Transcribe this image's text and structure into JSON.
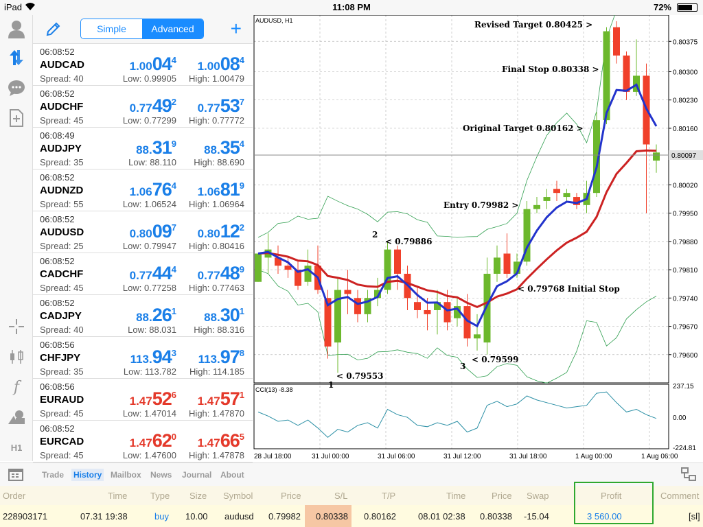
{
  "status": {
    "device": "iPad",
    "time": "11:08 PM",
    "battery": "72%"
  },
  "quotes_header": {
    "simple_label": "Simple",
    "advanced_label": "Advanced"
  },
  "quotes": [
    {
      "time": "06:08:52",
      "symbol": "AUDCAD",
      "spread": "Spread: 40",
      "low": "Low: 0.99905",
      "high": "High: 1.00479",
      "bid": [
        "1.00",
        "04",
        "4"
      ],
      "ask": [
        "1.00",
        "08",
        "4"
      ],
      "color": "blue"
    },
    {
      "time": "06:08:52",
      "symbol": "AUDCHF",
      "spread": "Spread: 45",
      "low": "Low: 0.77299",
      "high": "High: 0.77772",
      "bid": [
        "0.77",
        "49",
        "2"
      ],
      "ask": [
        "0.77",
        "53",
        "7"
      ],
      "color": "blue"
    },
    {
      "time": "06:08:49",
      "symbol": "AUDJPY",
      "spread": "Spread: 35",
      "low": "Low: 88.110",
      "high": "High: 88.690",
      "bid": [
        "88.",
        "31",
        "9"
      ],
      "ask": [
        "88.",
        "35",
        "4"
      ],
      "color": "blue"
    },
    {
      "time": "06:08:52",
      "symbol": "AUDNZD",
      "spread": "Spread: 55",
      "low": "Low: 1.06524",
      "high": "High: 1.06964",
      "bid": [
        "1.06",
        "76",
        "4"
      ],
      "ask": [
        "1.06",
        "81",
        "9"
      ],
      "color": "blue"
    },
    {
      "time": "06:08:52",
      "symbol": "AUDUSD",
      "spread": "Spread: 25",
      "low": "Low: 0.79947",
      "high": "High: 0.80416",
      "bid": [
        "0.80",
        "09",
        "7"
      ],
      "ask": [
        "0.80",
        "12",
        "2"
      ],
      "color": "blue"
    },
    {
      "time": "06:08:52",
      "symbol": "CADCHF",
      "spread": "Spread: 45",
      "low": "Low: 0.77258",
      "high": "High: 0.77463",
      "bid": [
        "0.77",
        "44",
        "4"
      ],
      "ask": [
        "0.77",
        "48",
        "9"
      ],
      "color": "blue"
    },
    {
      "time": "06:08:52",
      "symbol": "CADJPY",
      "spread": "Spread: 40",
      "low": "Low: 88.031",
      "high": "High: 88.316",
      "bid": [
        "88.",
        "26",
        "1"
      ],
      "ask": [
        "88.",
        "30",
        "1"
      ],
      "color": "blue"
    },
    {
      "time": "06:08:56",
      "symbol": "CHFJPY",
      "spread": "Spread: 35",
      "low": "Low: 113.782",
      "high": "High: 114.185",
      "bid": [
        "113.",
        "94",
        "3"
      ],
      "ask": [
        "113.",
        "97",
        "8"
      ],
      "color": "blue"
    },
    {
      "time": "06:08:56",
      "symbol": "EURAUD",
      "spread": "Spread: 45",
      "low": "Low: 1.47014",
      "high": "High: 1.47870",
      "bid": [
        "1.47",
        "52",
        "6"
      ],
      "ask": [
        "1.47",
        "57",
        "1"
      ],
      "color": "red"
    },
    {
      "time": "06:08:52",
      "symbol": "EURCAD",
      "spread": "Spread: 45",
      "low": "Low: 1.47600",
      "high": "High: 1.47878",
      "bid": [
        "1.47",
        "62",
        "0"
      ],
      "ask": [
        "1.47",
        "66",
        "5"
      ],
      "color": "red"
    }
  ],
  "chart": {
    "title": "AUDUSD, H1",
    "price_labels": [
      "0.80375",
      "0.80300",
      "0.80230",
      "0.80160",
      "0.80020",
      "0.79950",
      "0.79880",
      "0.79810",
      "0.79740",
      "0.79670",
      "0.79600"
    ],
    "current_price": "0.80097",
    "time_labels": [
      "28 Jul 18:00",
      "31 Jul 00:00",
      "31 Jul 06:00",
      "31 Jul 12:00",
      "31 Jul 18:00",
      "1 Aug 00:00",
      "1 Aug 06:00"
    ],
    "cci_label": "CCI(13) -8.38",
    "cci_scale": [
      "237.15",
      "0.00",
      "-224.81"
    ],
    "annotations": {
      "revised_target": "Revised Target 0.80425 >",
      "final_stop": "Final Stop 0.80338 >",
      "original_target": "Original Target 0.80162 >",
      "entry": "Entry 0.79982 >",
      "initial_stop": "< 0.79768 Initial Stop",
      "p1_value": "< 0.79553",
      "p2_value": "< 0.79886",
      "p3_value": "< 0.79599",
      "p1": "1",
      "p2": "2",
      "p3": "3"
    },
    "colors": {
      "bull": "#6cb82c",
      "bear": "#f0402a",
      "ema_fast": "#2233cc",
      "ema_slow": "#cc2222",
      "band": "#2e9e4e"
    },
    "candles": [
      [
        0.7978,
        0.7985,
        0.7985,
        0.7978
      ],
      [
        0.7984,
        0.7986,
        0.799,
        0.798
      ],
      [
        0.7984,
        0.7982,
        0.7987,
        0.798
      ],
      [
        0.7982,
        0.7981,
        0.7984,
        0.7979
      ],
      [
        0.7981,
        0.7977,
        0.7983,
        0.7976
      ],
      [
        0.7978,
        0.7982,
        0.7986,
        0.7977
      ],
      [
        0.7982,
        0.7976,
        0.7987,
        0.7975
      ],
      [
        0.7974,
        0.7962,
        0.7976,
        0.7959
      ],
      [
        0.7963,
        0.7976,
        0.7979,
        0.79555
      ],
      [
        0.7976,
        0.7975,
        0.7981,
        0.797
      ],
      [
        0.7974,
        0.797,
        0.7976,
        0.7968
      ],
      [
        0.797,
        0.7974,
        0.7976,
        0.7968
      ],
      [
        0.7974,
        0.7976,
        0.7979,
        0.7972
      ],
      [
        0.7976,
        0.7986,
        0.7988,
        0.7975
      ],
      [
        0.7986,
        0.798,
        0.7987,
        0.7976
      ],
      [
        0.798,
        0.7974,
        0.7982,
        0.7971
      ],
      [
        0.7973,
        0.7971,
        0.7977,
        0.7969
      ],
      [
        0.7971,
        0.797,
        0.7974,
        0.7966
      ],
      [
        0.7971,
        0.7973,
        0.7976,
        0.7965
      ],
      [
        0.7973,
        0.7968,
        0.7976,
        0.7966
      ],
      [
        0.7969,
        0.7972,
        0.7974,
        0.7967
      ],
      [
        0.7972,
        0.7964,
        0.7975,
        0.7962
      ],
      [
        0.7964,
        0.7965,
        0.797,
        0.7961
      ],
      [
        0.7963,
        0.798,
        0.7984,
        0.796
      ],
      [
        0.798,
        0.7984,
        0.7987,
        0.7978
      ],
      [
        0.7985,
        0.798,
        0.799,
        0.7979
      ],
      [
        0.798,
        0.7983,
        0.7985,
        0.7979
      ],
      [
        0.7983,
        0.7996,
        0.7998,
        0.7982
      ],
      [
        0.7996,
        0.7997,
        0.7999,
        0.7995
      ],
      [
        0.7998,
        0.7999,
        0.8001,
        0.7996
      ],
      [
        0.8001,
        0.8,
        0.8003,
        0.7998
      ],
      [
        0.7999,
        0.8,
        0.8001,
        0.7998
      ],
      [
        0.7999,
        0.7997,
        0.8,
        0.7996
      ],
      [
        0.7997,
        0.8,
        0.8003,
        0.7995
      ],
      [
        0.8,
        0.8018,
        0.802,
        0.7999
      ],
      [
        0.8018,
        0.804,
        0.8041,
        0.8017
      ],
      [
        0.8041,
        0.8034,
        0.80425,
        0.8032
      ],
      [
        0.8034,
        0.8025,
        0.8035,
        0.8023
      ],
      [
        0.8025,
        0.8029,
        0.8038,
        0.8024
      ],
      [
        0.8029,
        0.8012,
        0.8032,
        0.7995
      ],
      [
        0.8008,
        0.801,
        0.8012,
        0.8005
      ]
    ],
    "cci_values": [
      40,
      10,
      -30,
      -20,
      -60,
      -20,
      -80,
      -150,
      -90,
      -110,
      -60,
      -40,
      -80,
      60,
      20,
      0,
      -60,
      -70,
      -40,
      -60,
      -30,
      -110,
      -80,
      90,
      120,
      80,
      100,
      160,
      130,
      110,
      90,
      70,
      80,
      90,
      180,
      190,
      110,
      40,
      60,
      20,
      -8
    ]
  },
  "tabs": {
    "trade": "Trade",
    "history": "History",
    "mailbox": "Mailbox",
    "news": "News",
    "journal": "Journal",
    "about": "About"
  },
  "history": {
    "headers": {
      "order": "Order",
      "time": "Time",
      "type": "Type",
      "size": "Size",
      "symbol": "Symbol",
      "price": "Price",
      "sl": "S/L",
      "tp": "T/P",
      "time2": "Time",
      "price2": "Price",
      "swap": "Swap",
      "profit": "Profit",
      "comment": "Comment"
    },
    "row": {
      "order": "228903171",
      "time": "07.31 19:38",
      "type": "buy",
      "size": "10.00",
      "symbol": "audusd",
      "price": "0.79982",
      "sl": "0.80338",
      "tp": "0.80162",
      "time2": "08.01 02:38",
      "price2": "0.80338",
      "swap": "-15.04",
      "profit": "3 560.00",
      "comment": "[sl]"
    }
  }
}
